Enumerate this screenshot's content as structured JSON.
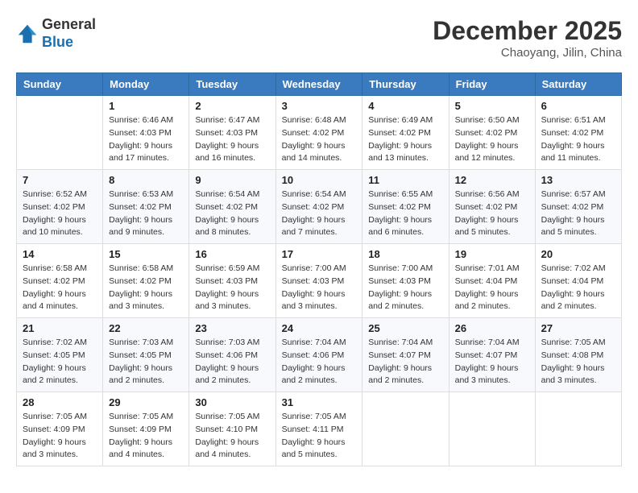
{
  "logo": {
    "general": "General",
    "blue": "Blue"
  },
  "header": {
    "month": "December 2025",
    "location": "Chaoyang, Jilin, China"
  },
  "weekdays": [
    "Sunday",
    "Monday",
    "Tuesday",
    "Wednesday",
    "Thursday",
    "Friday",
    "Saturday"
  ],
  "weeks": [
    [
      {
        "day": null
      },
      {
        "day": 1,
        "sunrise": "6:46 AM",
        "sunset": "4:03 PM",
        "daylight": "9 hours and 17 minutes."
      },
      {
        "day": 2,
        "sunrise": "6:47 AM",
        "sunset": "4:03 PM",
        "daylight": "9 hours and 16 minutes."
      },
      {
        "day": 3,
        "sunrise": "6:48 AM",
        "sunset": "4:02 PM",
        "daylight": "9 hours and 14 minutes."
      },
      {
        "day": 4,
        "sunrise": "6:49 AM",
        "sunset": "4:02 PM",
        "daylight": "9 hours and 13 minutes."
      },
      {
        "day": 5,
        "sunrise": "6:50 AM",
        "sunset": "4:02 PM",
        "daylight": "9 hours and 12 minutes."
      },
      {
        "day": 6,
        "sunrise": "6:51 AM",
        "sunset": "4:02 PM",
        "daylight": "9 hours and 11 minutes."
      }
    ],
    [
      {
        "day": 7,
        "sunrise": "6:52 AM",
        "sunset": "4:02 PM",
        "daylight": "9 hours and 10 minutes."
      },
      {
        "day": 8,
        "sunrise": "6:53 AM",
        "sunset": "4:02 PM",
        "daylight": "9 hours and 9 minutes."
      },
      {
        "day": 9,
        "sunrise": "6:54 AM",
        "sunset": "4:02 PM",
        "daylight": "9 hours and 8 minutes."
      },
      {
        "day": 10,
        "sunrise": "6:54 AM",
        "sunset": "4:02 PM",
        "daylight": "9 hours and 7 minutes."
      },
      {
        "day": 11,
        "sunrise": "6:55 AM",
        "sunset": "4:02 PM",
        "daylight": "9 hours and 6 minutes."
      },
      {
        "day": 12,
        "sunrise": "6:56 AM",
        "sunset": "4:02 PM",
        "daylight": "9 hours and 5 minutes."
      },
      {
        "day": 13,
        "sunrise": "6:57 AM",
        "sunset": "4:02 PM",
        "daylight": "9 hours and 5 minutes."
      }
    ],
    [
      {
        "day": 14,
        "sunrise": "6:58 AM",
        "sunset": "4:02 PM",
        "daylight": "9 hours and 4 minutes."
      },
      {
        "day": 15,
        "sunrise": "6:58 AM",
        "sunset": "4:02 PM",
        "daylight": "9 hours and 3 minutes."
      },
      {
        "day": 16,
        "sunrise": "6:59 AM",
        "sunset": "4:03 PM",
        "daylight": "9 hours and 3 minutes."
      },
      {
        "day": 17,
        "sunrise": "7:00 AM",
        "sunset": "4:03 PM",
        "daylight": "9 hours and 3 minutes."
      },
      {
        "day": 18,
        "sunrise": "7:00 AM",
        "sunset": "4:03 PM",
        "daylight": "9 hours and 2 minutes."
      },
      {
        "day": 19,
        "sunrise": "7:01 AM",
        "sunset": "4:04 PM",
        "daylight": "9 hours and 2 minutes."
      },
      {
        "day": 20,
        "sunrise": "7:02 AM",
        "sunset": "4:04 PM",
        "daylight": "9 hours and 2 minutes."
      }
    ],
    [
      {
        "day": 21,
        "sunrise": "7:02 AM",
        "sunset": "4:05 PM",
        "daylight": "9 hours and 2 minutes."
      },
      {
        "day": 22,
        "sunrise": "7:03 AM",
        "sunset": "4:05 PM",
        "daylight": "9 hours and 2 minutes."
      },
      {
        "day": 23,
        "sunrise": "7:03 AM",
        "sunset": "4:06 PM",
        "daylight": "9 hours and 2 minutes."
      },
      {
        "day": 24,
        "sunrise": "7:04 AM",
        "sunset": "4:06 PM",
        "daylight": "9 hours and 2 minutes."
      },
      {
        "day": 25,
        "sunrise": "7:04 AM",
        "sunset": "4:07 PM",
        "daylight": "9 hours and 2 minutes."
      },
      {
        "day": 26,
        "sunrise": "7:04 AM",
        "sunset": "4:07 PM",
        "daylight": "9 hours and 3 minutes."
      },
      {
        "day": 27,
        "sunrise": "7:05 AM",
        "sunset": "4:08 PM",
        "daylight": "9 hours and 3 minutes."
      }
    ],
    [
      {
        "day": 28,
        "sunrise": "7:05 AM",
        "sunset": "4:09 PM",
        "daylight": "9 hours and 3 minutes."
      },
      {
        "day": 29,
        "sunrise": "7:05 AM",
        "sunset": "4:09 PM",
        "daylight": "9 hours and 4 minutes."
      },
      {
        "day": 30,
        "sunrise": "7:05 AM",
        "sunset": "4:10 PM",
        "daylight": "9 hours and 4 minutes."
      },
      {
        "day": 31,
        "sunrise": "7:05 AM",
        "sunset": "4:11 PM",
        "daylight": "9 hours and 5 minutes."
      },
      {
        "day": null
      },
      {
        "day": null
      },
      {
        "day": null
      }
    ]
  ]
}
